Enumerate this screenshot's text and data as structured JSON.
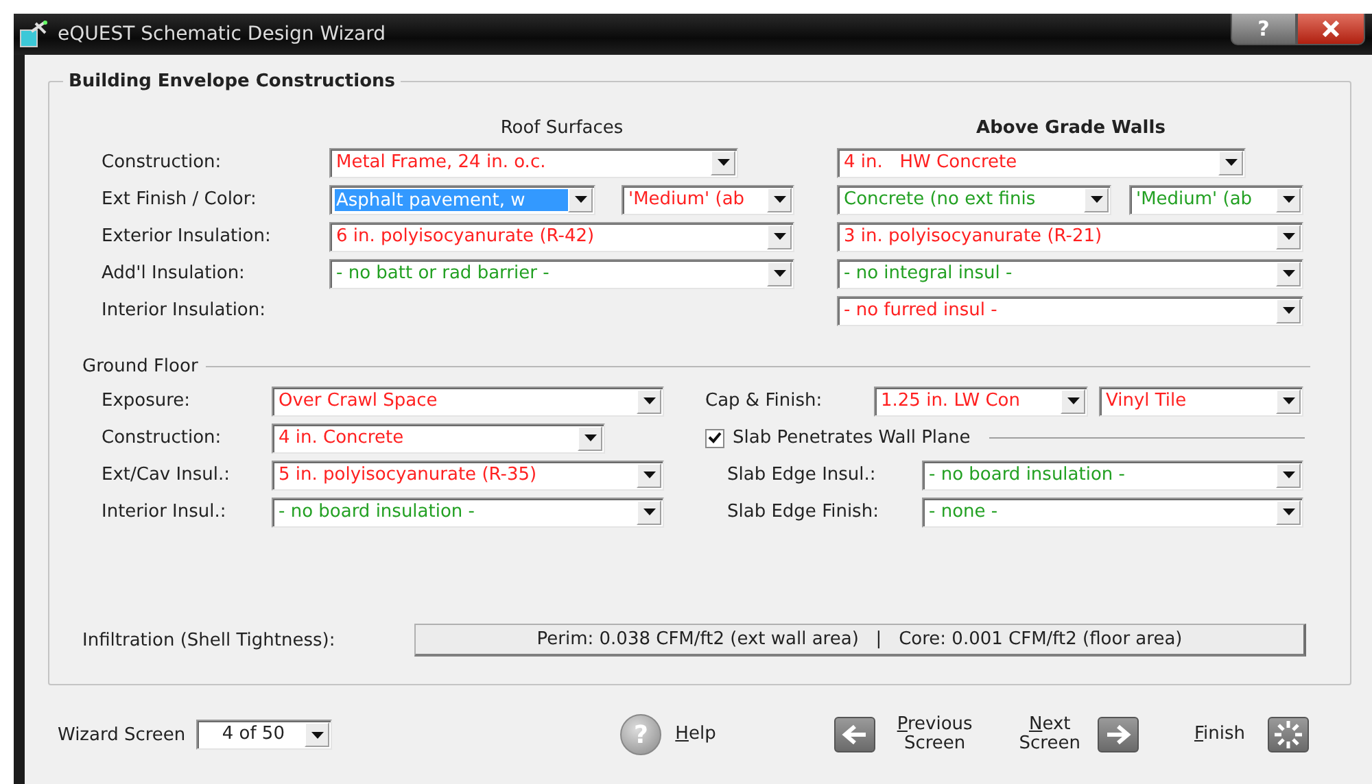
{
  "window": {
    "title": "eQUEST Schematic Design Wizard",
    "help_glyph": "?"
  },
  "envelope": {
    "title": "Building Envelope Constructions",
    "columns": [
      "Roof Surfaces",
      "Above Grade Walls"
    ],
    "rows": [
      {
        "label": "Construction:",
        "roof": [
          {
            "value": "Metal Frame, 24 in. o.c.",
            "color": "#ff2020",
            "focused": false
          }
        ],
        "walls": [
          {
            "value": "4 in.   HW Concrete",
            "color": "#ff2020",
            "focused": false
          }
        ]
      },
      {
        "label": "Ext Finish / Color:",
        "roof": [
          {
            "value": "Asphalt pavement, w",
            "focused": true
          },
          {
            "value": "'Medium' (ab",
            "color": "#ff2020",
            "focused": false
          }
        ],
        "walls": [
          {
            "value": "Concrete (no ext finis",
            "color": "#22a022",
            "focused": false
          },
          {
            "value": "'Medium' (ab",
            "color": "#22a022",
            "focused": false
          }
        ]
      },
      {
        "label": "Exterior Insulation:",
        "roof": [
          {
            "value": "6 in. polyisocyanurate (R-42)",
            "color": "#ff2020",
            "focused": false
          }
        ],
        "walls": [
          {
            "value": "3 in. polyisocyanurate (R-21)",
            "color": "#ff2020",
            "focused": false
          }
        ]
      },
      {
        "label": "Add'l Insulation:",
        "roof": [
          {
            "value": "- no batt or rad barrier -",
            "color": "#22a022",
            "focused": false
          }
        ],
        "walls": [
          {
            "value": "- no integral insul -",
            "color": "#22a022",
            "focused": false
          }
        ]
      },
      {
        "label": "Interior Insulation:",
        "walls": [
          {
            "value": "- no furred insul -",
            "color": "#ff2020",
            "focused": false
          }
        ]
      }
    ]
  },
  "ground_floor": {
    "title": "Ground Floor",
    "left": [
      {
        "label": "Exposure:",
        "combos": [
          {
            "value": "Over Crawl Space",
            "color": "#ff2020",
            "focused": false
          }
        ]
      },
      {
        "label": "Construction:",
        "combos": [
          {
            "value": "4 in. Concrete",
            "color": "#ff2020",
            "focused": false
          }
        ]
      },
      {
        "label": "Ext/Cav Insul.:",
        "combos": [
          {
            "value": "5 in. polyisocyanurate (R-35)",
            "color": "#ff2020",
            "focused": false
          }
        ]
      },
      {
        "label": "Interior Insul.:",
        "combos": [
          {
            "value": "- no board insulation -",
            "color": "#22a022",
            "focused": false
          }
        ]
      }
    ],
    "right": [
      {
        "kind": "combo",
        "label": "Cap & Finish:",
        "combos": [
          {
            "value": "1.25 in. LW Con",
            "color": "#ff2020",
            "focused": false
          },
          {
            "value": "Vinyl Tile",
            "color": "#ff2020",
            "focused": false
          }
        ]
      },
      {
        "kind": "checkbox",
        "label": "Slab Penetrates Wall Plane",
        "checked": true,
        "children": [
          {
            "label": "Slab Edge Insul.:",
            "combos": [
              {
                "value": "- no board insulation -",
                "color": "#22a022",
                "focused": false
              }
            ]
          },
          {
            "label": "Slab Edge Finish:",
            "combos": [
              {
                "value": "- none -",
                "color": "#22a022",
                "focused": false
              }
            ]
          }
        ]
      }
    ]
  },
  "infiltration": {
    "label": "Infiltration (Shell Tightness):",
    "value": "Perim: 0.038 CFM/ft2 (ext wall area)   |   Core: 0.001 CFM/ft2 (floor area)"
  },
  "footer": {
    "wizard_screen_label": "Wizard Screen",
    "wizard_screen": "4 of 50",
    "buttons": [
      {
        "kind": "help",
        "lines": [
          "Help"
        ],
        "glyph": "?"
      },
      {
        "kind": "previous",
        "lines": [
          "Previous",
          "Screen"
        ]
      },
      {
        "kind": "next",
        "lines": [
          "Next",
          "Screen"
        ]
      },
      {
        "kind": "finish",
        "lines": [
          "Finish"
        ]
      }
    ]
  }
}
